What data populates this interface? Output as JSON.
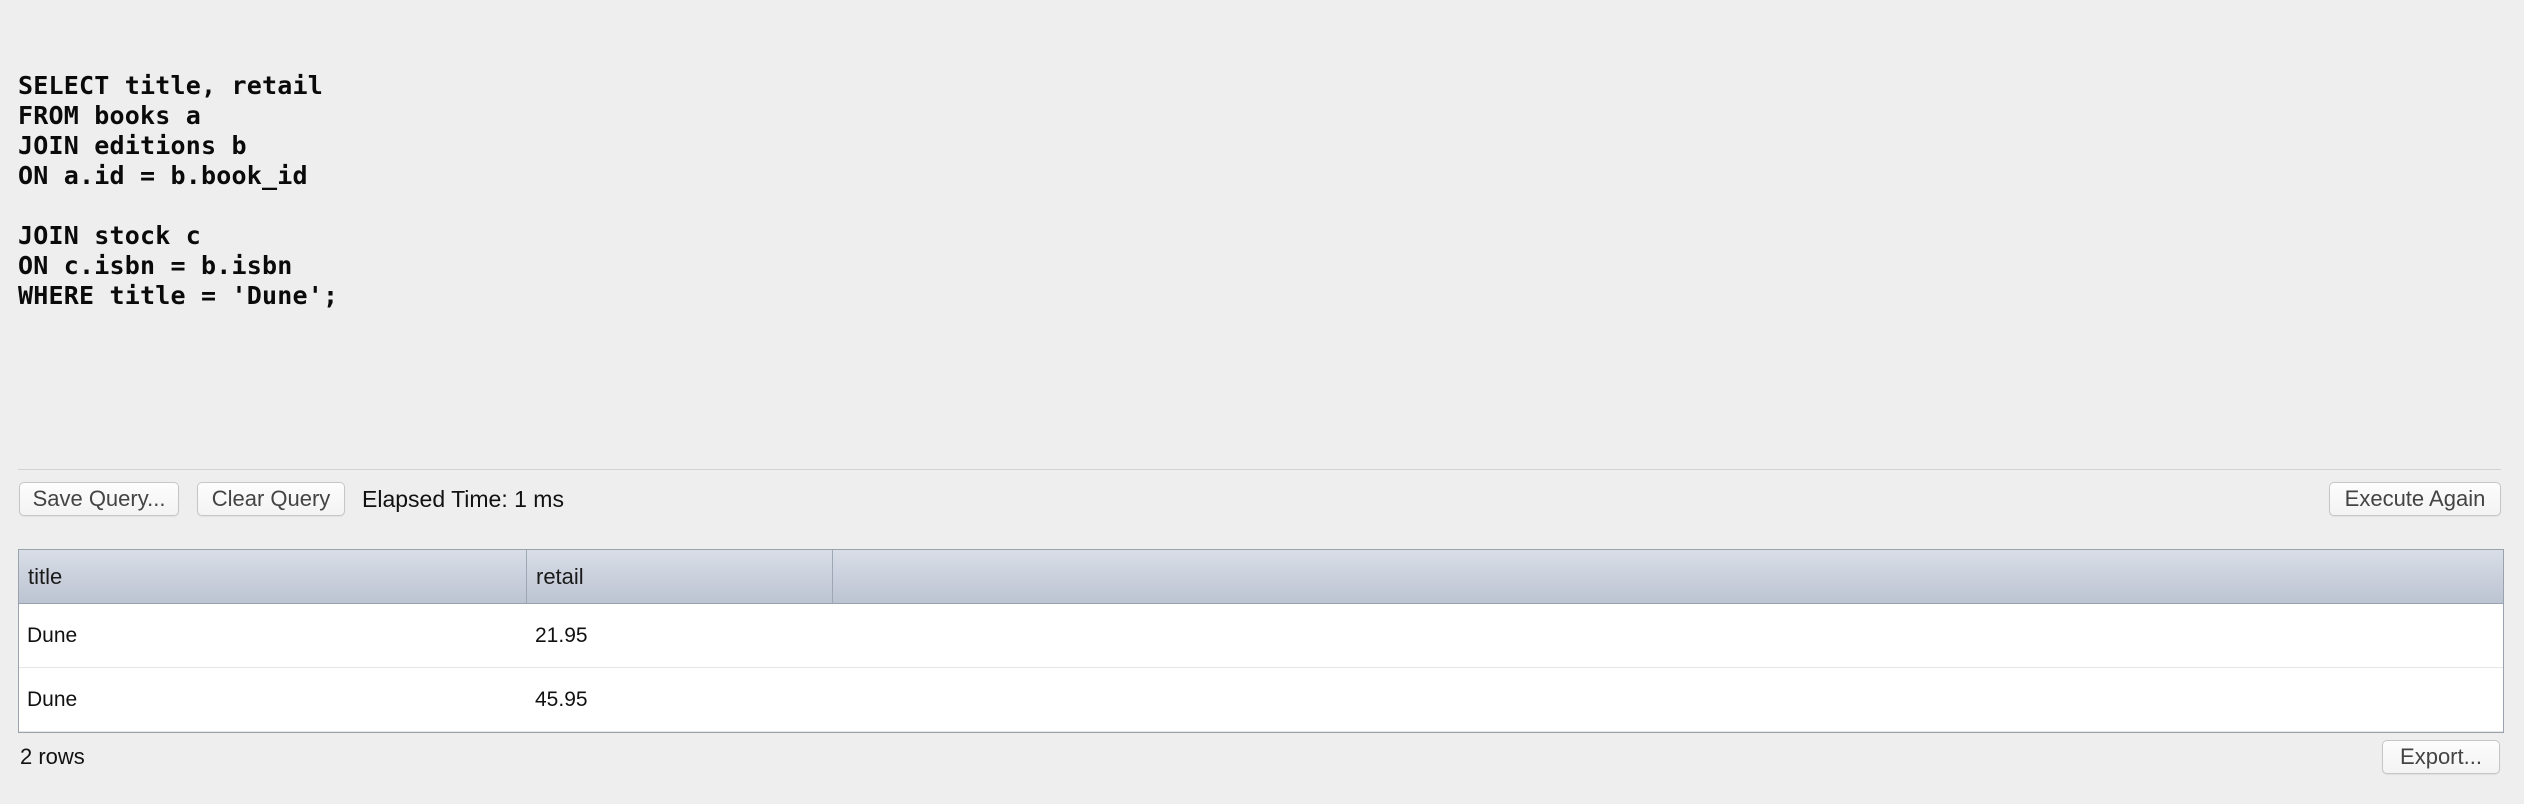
{
  "editor": {
    "lines": [
      "SELECT title, retail",
      "FROM books a",
      "JOIN editions b",
      "ON a.id = b.book_id",
      "",
      "JOIN stock c",
      "ON c.isbn = b.isbn",
      "WHERE title = 'Dune';"
    ]
  },
  "toolbar": {
    "save_label": "Save Query...",
    "clear_label": "Clear Query",
    "elapsed_text": "Elapsed Time: 1 ms",
    "execute_label": "Execute Again"
  },
  "results": {
    "columns": [
      "title",
      "retail"
    ],
    "rows": [
      [
        "Dune",
        "21.95"
      ],
      [
        "Dune",
        "45.95"
      ]
    ]
  },
  "footer": {
    "row_count": "2 rows",
    "export_label": "Export..."
  }
}
